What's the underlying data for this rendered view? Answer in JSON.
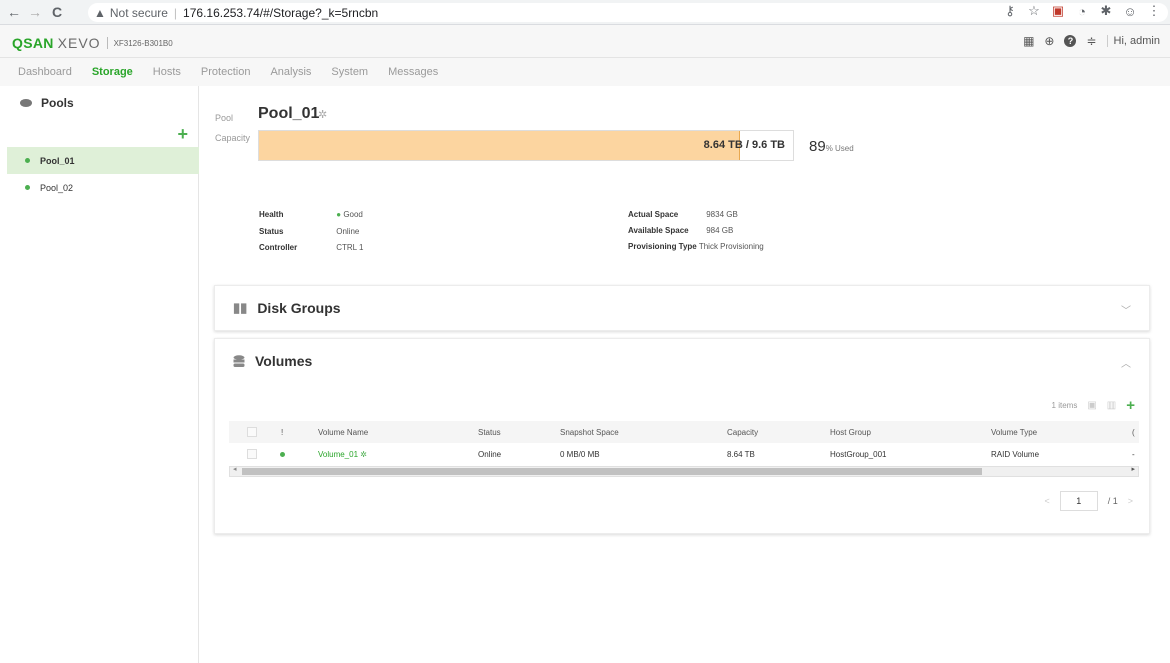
{
  "browser": {
    "back_glyph": "←",
    "forward_glyph": "→",
    "reload_glyph": "C",
    "warning_glyph": "▲",
    "not_secure": "Not secure",
    "url": "176.16.253.74/#/Storage?_k=5rncbn",
    "icons": [
      "key-icon",
      "star-icon",
      "pdf-icon",
      "circle-icon",
      "extensions-icon",
      "profile-icon",
      "menu-icon"
    ],
    "icon_glyphs": [
      "⚷",
      "☆",
      "▣",
      "◔",
      "✱",
      "☺",
      "⋮"
    ]
  },
  "app": {
    "brand": "QSAN",
    "product": "XEVO",
    "model": "XF3126-B301B0",
    "header_icons": [
      "grid-icon",
      "globe-icon",
      "help-icon",
      "network-icon"
    ],
    "header_glyphs": [
      "▦",
      "⊕",
      "?",
      "≑"
    ],
    "user_greeting": "Hi, admin"
  },
  "nav": {
    "tabs": [
      "Dashboard",
      "Storage",
      "Hosts",
      "Protection",
      "Analysis",
      "System",
      "Messages"
    ],
    "active": "Storage"
  },
  "sidebar": {
    "title": "Pools",
    "add_glyph": "+",
    "items": [
      {
        "label": "Pool_01",
        "selected": true
      },
      {
        "label": "Pool_02",
        "selected": false
      }
    ]
  },
  "pool": {
    "label": "Pool",
    "name": "Pool_01",
    "capacity_label": "Capacity",
    "used": "8.64 TB",
    "total": "/ 9.6 TB",
    "used_fraction": 0.9,
    "percent": "89",
    "percent_suffix": "% ",
    "used_word": "Used",
    "health_label": "Health",
    "health_value": "Good",
    "status_label": "Status",
    "status_value": "Online",
    "controller_label": "Controller",
    "controller_value": "CTRL 1",
    "actual_space_label": "Actual Space",
    "actual_space_value": "9834 GB",
    "available_space_label": "Available Space",
    "available_space_value": "984 GB",
    "provisioning_label": "Provisioning Type",
    "provisioning_value": "Thick Provisioning"
  },
  "disk_groups": {
    "title": "Disk Groups",
    "chevron": "﹀"
  },
  "volumes": {
    "title": "Volumes",
    "chevron": "︿",
    "items_count": "1 items",
    "add_glyph": "+",
    "columns": [
      "!",
      "Volume Name",
      "Status",
      "Snapshot Space",
      "Capacity",
      "Host Group",
      "Volume Type",
      "("
    ],
    "rows": [
      {
        "name": "Volume_01",
        "status": "Online",
        "snapshot": "0 MB/0 MB",
        "capacity": "8.64 TB",
        "host_group": "HostGroup_001",
        "type": "RAID Volume",
        "extra": "-"
      }
    ],
    "pager": {
      "prev": "<",
      "page": "1",
      "of": "/ 1",
      "next": ">"
    }
  }
}
